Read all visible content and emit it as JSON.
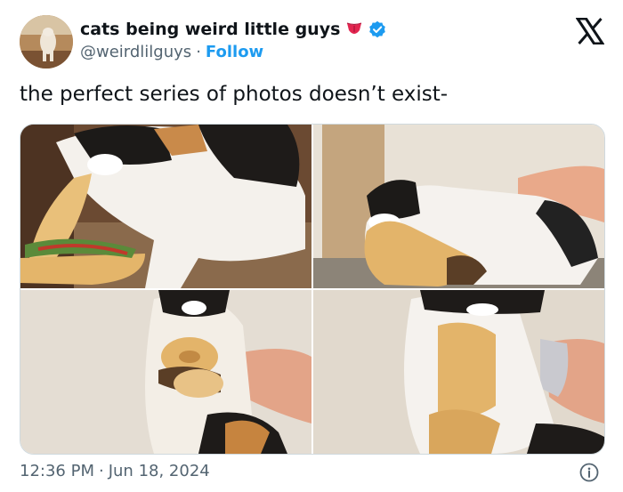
{
  "author": {
    "display_name": "cats being weird little guys",
    "handle": "@weirdlilguys",
    "follow_label": "Follow",
    "separator": "·",
    "avatar_icon": "cat-avatar",
    "emoji_icon": "tongue-emoji-icon",
    "verified_icon": "verified-badge-icon"
  },
  "tweet": {
    "text": "the perfect series of photos doesn’t exist-"
  },
  "media": {
    "photos": [
      {
        "name": "photo-cat-biting-sandwich"
      },
      {
        "name": "photo-cat-lying-on-bread"
      },
      {
        "name": "photo-cat-holding-bagel"
      },
      {
        "name": "photo-cat-hugging-bread"
      }
    ]
  },
  "footer": {
    "time": "12:36 PM",
    "separator": "·",
    "date": "Jun 18, 2024",
    "info_icon": "info-icon"
  },
  "colors": {
    "text": "#0f1419",
    "muted": "#536471",
    "link": "#1d9bf0",
    "border": "#cfd9de"
  }
}
